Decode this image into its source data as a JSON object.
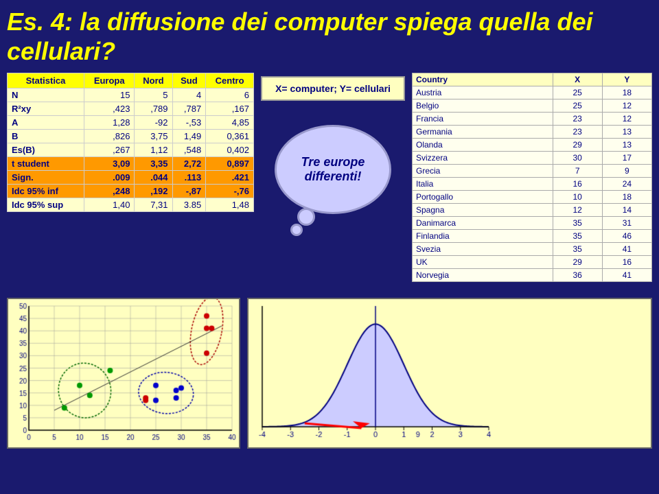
{
  "title": "Es. 4: la diffusione dei computer spiega quella dei cellulari?",
  "formula": "X= computer; Y= cellulari",
  "thought_text": "Tre europe differenti!",
  "stats": {
    "headers": [
      "Statistica",
      "Europa",
      "Nord",
      "Sud",
      "Centro"
    ],
    "rows": [
      [
        "N",
        "15",
        "5",
        "4",
        "6"
      ],
      [
        "R²xy",
        ",423",
        ",789",
        ",787",
        ",167"
      ],
      [
        "A",
        "1,28",
        "-92",
        "-,53",
        "4,85"
      ],
      [
        "B",
        ",826",
        "3,75",
        "1,49",
        "0,361"
      ],
      [
        "Es(B)",
        ",267",
        "1,12",
        ",548",
        "0,402"
      ],
      [
        "t student",
        "3,09",
        "3,35",
        "2,72",
        "0,897"
      ],
      [
        "Sign.",
        ".009",
        ".044",
        ".113",
        ".421"
      ],
      [
        "Idc 95% inf",
        ",248",
        ",192",
        "-,87",
        "-,76"
      ],
      [
        "Idc 95% sup",
        "1,40",
        "7,31",
        "3.85",
        "1,48"
      ]
    ]
  },
  "countries": {
    "headers": [
      "Country",
      "X",
      "Y"
    ],
    "rows": [
      [
        "Austria",
        "25",
        "18"
      ],
      [
        "Belgio",
        "25",
        "12"
      ],
      [
        "Francia",
        "23",
        "12"
      ],
      [
        "Germania",
        "23",
        "13"
      ],
      [
        "Olanda",
        "29",
        "13"
      ],
      [
        "Svizzera",
        "30",
        "17"
      ],
      [
        "Grecia",
        "7",
        "9"
      ],
      [
        "Italia",
        "16",
        "24"
      ],
      [
        "Portogallo",
        "10",
        "18"
      ],
      [
        "Spagna",
        "12",
        "14"
      ],
      [
        "Danimarca",
        "35",
        "31"
      ],
      [
        "Finlandia",
        "35",
        "46"
      ],
      [
        "Svezia",
        "35",
        "41"
      ],
      [
        "UK",
        "29",
        "16"
      ],
      [
        "Norvegia",
        "36",
        "41"
      ]
    ]
  },
  "scatter": {
    "x_axis": [
      0,
      5,
      10,
      15,
      20,
      25,
      30,
      35,
      40
    ],
    "y_axis": [
      0,
      5,
      10,
      15,
      20,
      25,
      30,
      35,
      40,
      45,
      50
    ],
    "points_europa": [
      {
        "x": 7,
        "y": 9,
        "group": "sud"
      },
      {
        "x": 10,
        "y": 18,
        "group": "sud"
      },
      {
        "x": 12,
        "y": 14,
        "group": "sud"
      },
      {
        "x": 16,
        "y": 24,
        "group": "sud"
      },
      {
        "x": 23,
        "y": 12,
        "group": "nord"
      },
      {
        "x": 23,
        "y": 13,
        "group": "nord"
      },
      {
        "x": 25,
        "y": 18,
        "group": "centro"
      },
      {
        "x": 25,
        "y": 12,
        "group": "centro"
      },
      {
        "x": 29,
        "y": 13,
        "group": "centro"
      },
      {
        "x": 29,
        "y": 16,
        "group": "centro"
      },
      {
        "x": 30,
        "y": 17,
        "group": "centro"
      },
      {
        "x": 35,
        "y": 31,
        "group": "nord"
      },
      {
        "x": 35,
        "y": 46,
        "group": "nord"
      },
      {
        "x": 35,
        "y": 41,
        "group": "nord"
      },
      {
        "x": 36,
        "y": 41,
        "group": "nord"
      }
    ]
  },
  "normal_dist": {
    "x_axis": [
      -4,
      -3,
      -2,
      -1,
      0,
      1,
      2,
      3,
      4
    ],
    "critical_value": 9
  }
}
